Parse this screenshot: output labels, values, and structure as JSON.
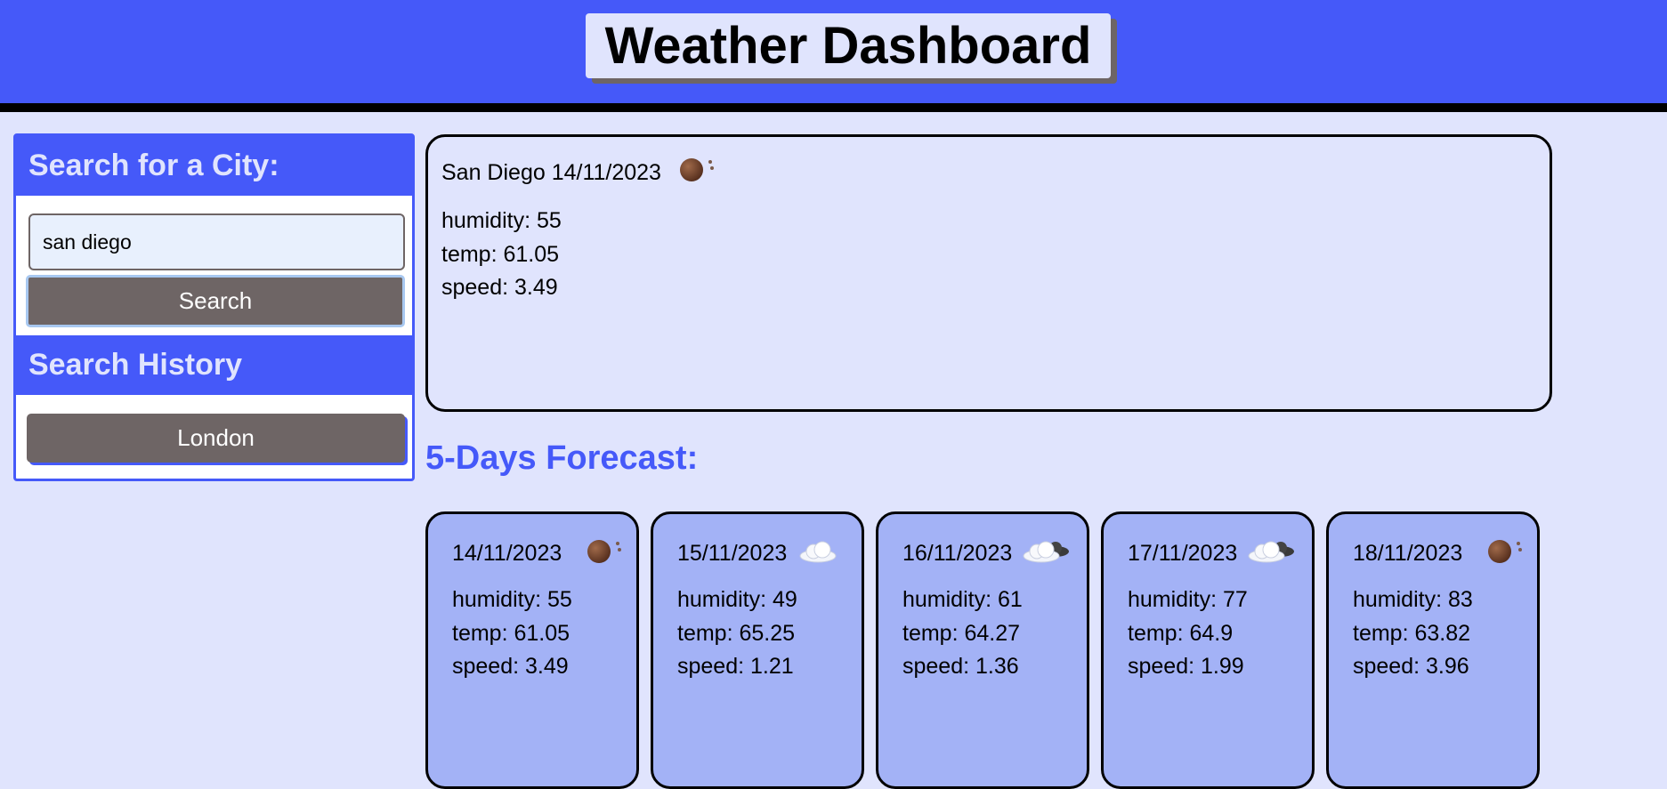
{
  "header": {
    "title": "Weather Dashboard"
  },
  "sidebar": {
    "search_heading": "Search for a City:",
    "search_value": "san diego",
    "search_button": "Search",
    "history_heading": "Search History",
    "history": [
      "London"
    ]
  },
  "current": {
    "heading": "San Diego 14/11/2023",
    "icon": "night-clear-icon",
    "humidity": "humidity: 55",
    "temp": "temp: 61.05",
    "speed": "speed: 3.49"
  },
  "forecast": {
    "title": "5-Days Forecast:",
    "days": [
      {
        "date": "14/11/2023",
        "icon": "night-clear-icon",
        "humidity": "humidity: 55",
        "temp": "temp: 61.05",
        "speed": "speed: 3.49"
      },
      {
        "date": "15/11/2023",
        "icon": "cloud-icon",
        "humidity": "humidity: 49",
        "temp": "temp: 65.25",
        "speed": "speed: 1.21"
      },
      {
        "date": "16/11/2023",
        "icon": "broken-clouds-icon",
        "humidity": "humidity: 61",
        "temp": "temp: 64.27",
        "speed": "speed: 1.36"
      },
      {
        "date": "17/11/2023",
        "icon": "broken-clouds-icon",
        "humidity": "humidity: 77",
        "temp": "temp: 64.9",
        "speed": "speed: 1.99"
      },
      {
        "date": "18/11/2023",
        "icon": "night-clear-icon",
        "humidity": "humidity: 83",
        "temp": "temp: 63.82",
        "speed": "speed: 3.96"
      }
    ]
  },
  "colors": {
    "header": "#4559f9",
    "page": "#e0e4fd",
    "card": "#a3b2f6",
    "button": "#6e6565"
  }
}
